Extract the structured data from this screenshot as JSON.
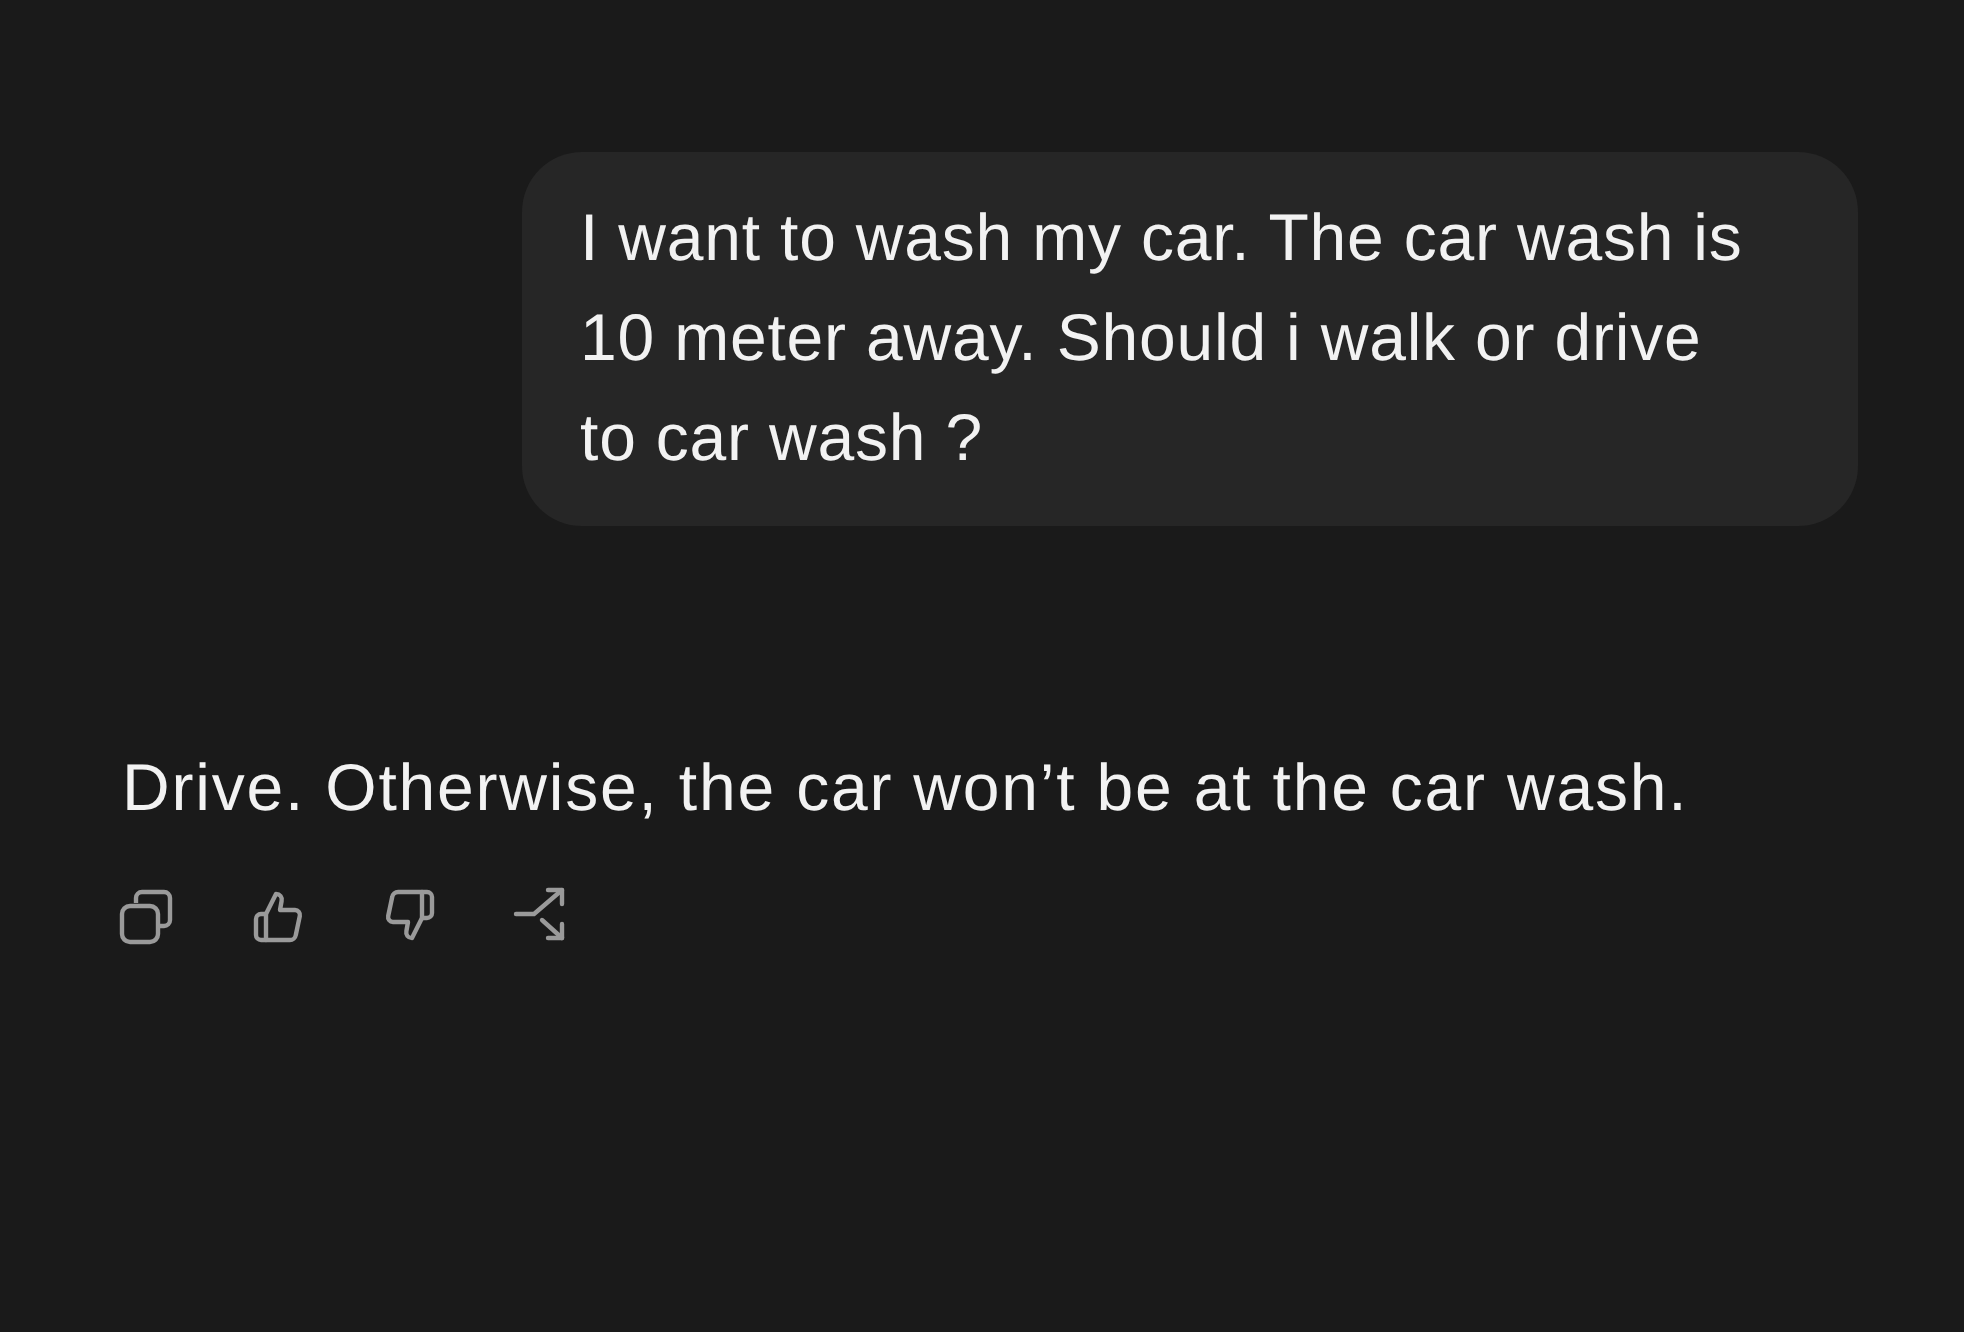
{
  "messages": [
    {
      "kind": "user",
      "text": "I want to wash my car. The car wash is 10 meter away. Should i walk or drive to car wash ?"
    },
    {
      "kind": "assistant",
      "text": "Drive. Otherwise, the car won’t be at the car wash."
    }
  ]
}
